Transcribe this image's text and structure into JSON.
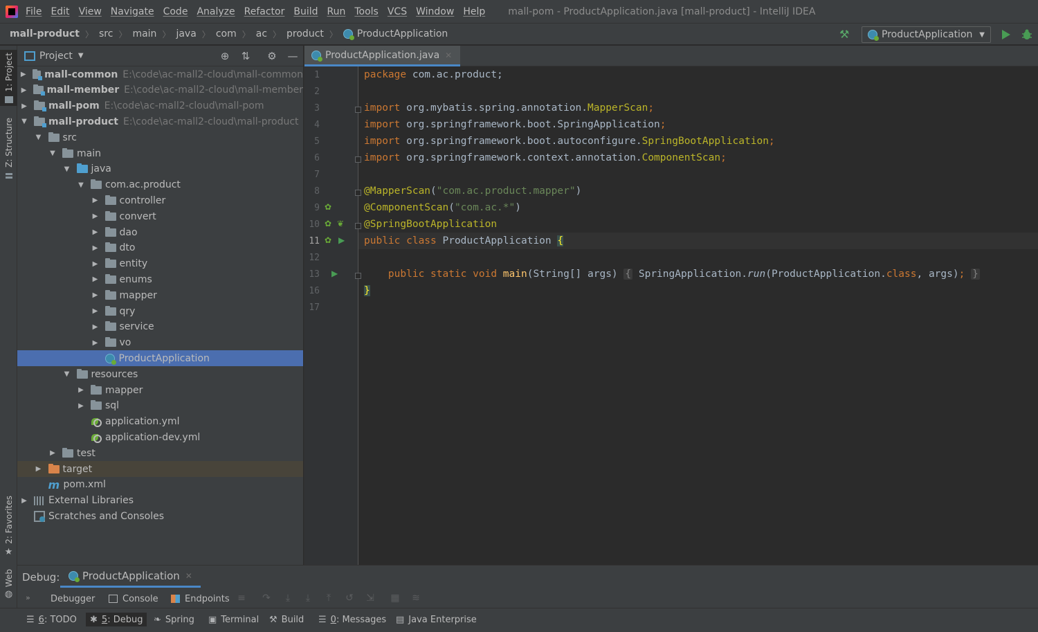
{
  "menubar": {
    "items": [
      "File",
      "Edit",
      "View",
      "Navigate",
      "Code",
      "Analyze",
      "Refactor",
      "Build",
      "Run",
      "Tools",
      "VCS",
      "Window",
      "Help"
    ],
    "window_title": "mall-pom - ProductApplication.java [mall-product] - IntelliJ IDEA"
  },
  "navbar": {
    "crumbs": [
      "mall-product",
      "src",
      "main",
      "java",
      "com",
      "ac",
      "product",
      "ProductApplication"
    ],
    "run_config": "ProductApplication"
  },
  "left_stripe": {
    "project_tab": "1: Project",
    "structure_tab": "Z: Structure",
    "favorites_tab": "2: Favorites",
    "web_tab": "Web"
  },
  "project_panel": {
    "title": "Project",
    "tree": [
      {
        "name": "mall-common",
        "path": "E:\\code\\ac-mall2-cloud\\mall-common",
        "depth": 0,
        "arrow": "collapsed",
        "icon": "module-folder",
        "bold": true
      },
      {
        "name": "mall-member",
        "path": "E:\\code\\ac-mall2-cloud\\mall-member",
        "depth": 0,
        "arrow": "collapsed",
        "icon": "module-folder",
        "bold": true
      },
      {
        "name": "mall-pom",
        "path": "E:\\code\\ac-mall2-cloud\\mall-pom",
        "depth": 0,
        "arrow": "collapsed",
        "icon": "module-folder",
        "bold": true
      },
      {
        "name": "mall-product",
        "path": "E:\\code\\ac-mall2-cloud\\mall-product",
        "depth": 0,
        "arrow": "expanded",
        "icon": "module-folder",
        "bold": true
      },
      {
        "name": "src",
        "path": "",
        "depth": 1,
        "arrow": "expanded",
        "icon": "folder"
      },
      {
        "name": "main",
        "path": "",
        "depth": 2,
        "arrow": "expanded",
        "icon": "folder"
      },
      {
        "name": "java",
        "path": "",
        "depth": 3,
        "arrow": "expanded",
        "icon": "source-folder"
      },
      {
        "name": "com.ac.product",
        "path": "",
        "depth": 4,
        "arrow": "expanded",
        "icon": "package"
      },
      {
        "name": "controller",
        "path": "",
        "depth": 5,
        "arrow": "collapsed",
        "icon": "package"
      },
      {
        "name": "convert",
        "path": "",
        "depth": 5,
        "arrow": "collapsed",
        "icon": "package"
      },
      {
        "name": "dao",
        "path": "",
        "depth": 5,
        "arrow": "collapsed",
        "icon": "package"
      },
      {
        "name": "dto",
        "path": "",
        "depth": 5,
        "arrow": "collapsed",
        "icon": "package"
      },
      {
        "name": "entity",
        "path": "",
        "depth": 5,
        "arrow": "collapsed",
        "icon": "package"
      },
      {
        "name": "enums",
        "path": "",
        "depth": 5,
        "arrow": "collapsed",
        "icon": "package"
      },
      {
        "name": "mapper",
        "path": "",
        "depth": 5,
        "arrow": "collapsed",
        "icon": "package"
      },
      {
        "name": "qry",
        "path": "",
        "depth": 5,
        "arrow": "collapsed",
        "icon": "package"
      },
      {
        "name": "service",
        "path": "",
        "depth": 5,
        "arrow": "collapsed",
        "icon": "package"
      },
      {
        "name": "vo",
        "path": "",
        "depth": 5,
        "arrow": "collapsed",
        "icon": "package"
      },
      {
        "name": "ProductApplication",
        "path": "",
        "depth": 5,
        "arrow": "none",
        "icon": "spring-class",
        "selected": true
      },
      {
        "name": "resources",
        "path": "",
        "depth": 3,
        "arrow": "expanded",
        "icon": "resources-folder"
      },
      {
        "name": "mapper",
        "path": "",
        "depth": 4,
        "arrow": "collapsed",
        "icon": "folder"
      },
      {
        "name": "sql",
        "path": "",
        "depth": 4,
        "arrow": "collapsed",
        "icon": "folder"
      },
      {
        "name": "application.yml",
        "path": "",
        "depth": 4,
        "arrow": "none",
        "icon": "yml"
      },
      {
        "name": "application-dev.yml",
        "path": "",
        "depth": 4,
        "arrow": "none",
        "icon": "yml"
      },
      {
        "name": "test",
        "path": "",
        "depth": 2,
        "arrow": "collapsed",
        "icon": "folder"
      },
      {
        "name": "target",
        "path": "",
        "depth": 1,
        "arrow": "collapsed",
        "icon": "excluded-folder",
        "excluded": true
      },
      {
        "name": "pom.xml",
        "path": "",
        "depth": 1,
        "arrow": "none",
        "icon": "maven"
      },
      {
        "name": "External Libraries",
        "path": "",
        "depth": 0,
        "arrow": "collapsed",
        "icon": "libraries"
      },
      {
        "name": "Scratches and Consoles",
        "path": "",
        "depth": 0,
        "arrow": "none",
        "icon": "scratches"
      }
    ]
  },
  "editor": {
    "tab": "ProductApplication.java",
    "line_numbers": [
      "1",
      "2",
      "3",
      "4",
      "5",
      "6",
      "7",
      "8",
      "9",
      "10",
      "11",
      "12",
      "13",
      "16",
      "17"
    ],
    "current_line": "11",
    "code": {
      "l1": {
        "kw": "package",
        "rest": " com.ac.product;"
      },
      "l3": {
        "kw": "import",
        "pkg": " org.mybatis.spring.annotation.",
        "cls": "MapperScan",
        "end": ";"
      },
      "l4": {
        "kw": "import",
        "pkg": " org.springframework.boot.SpringApplication",
        "end": ";"
      },
      "l5": {
        "kw": "import",
        "pkg": " org.springframework.boot.autoconfigure.",
        "cls": "SpringBootApplication",
        "end": ";"
      },
      "l6": {
        "kw": "import",
        "pkg": " org.springframework.context.annotation.",
        "cls": "ComponentScan",
        "end": ";"
      },
      "l8": {
        "ann": "@MapperScan",
        "open": "(",
        "str": "\"com.ac.product.mapper\"",
        "close": ")"
      },
      "l9": {
        "ann": "@ComponentScan",
        "open": "(",
        "str": "\"com.ac.*\"",
        "close": ")"
      },
      "l10": {
        "ann": "@SpringBootApplication"
      },
      "l11": {
        "kw": "public class",
        "name": " ProductApplication ",
        "brace": "{"
      },
      "l13": {
        "kw": "public static void",
        "method": " main",
        "params": "(String[] args) ",
        "fold_open": "{",
        "call1": " SpringApplication.",
        "run": "run",
        "call2": "(ProductApplication.",
        "classkw": "class",
        "args": ", args)",
        "semi": ";",
        "fold_close": "}"
      },
      "l16": {
        "brace": "}"
      }
    }
  },
  "debug_panel": {
    "title": "Debug:",
    "session": "ProductApplication",
    "tabs": [
      "Debugger",
      "Console",
      "Endpoints"
    ]
  },
  "bottom_stripe": {
    "tabs": [
      {
        "num": "6",
        "label": ": TODO"
      },
      {
        "num": "5",
        "label": ": Debug"
      },
      {
        "num": "",
        "label": "Spring"
      },
      {
        "num": "",
        "label": "Terminal"
      },
      {
        "num": "",
        "label": "Build"
      },
      {
        "num": "0",
        "label": ": Messages"
      },
      {
        "num": "",
        "label": "Java Enterprise"
      }
    ]
  },
  "colors": {
    "selection": "#4b6eaf",
    "keyword": "#cc7832",
    "annotation": "#bbb529",
    "string": "#6a8759",
    "accent_tab": "#4a88c7"
  }
}
